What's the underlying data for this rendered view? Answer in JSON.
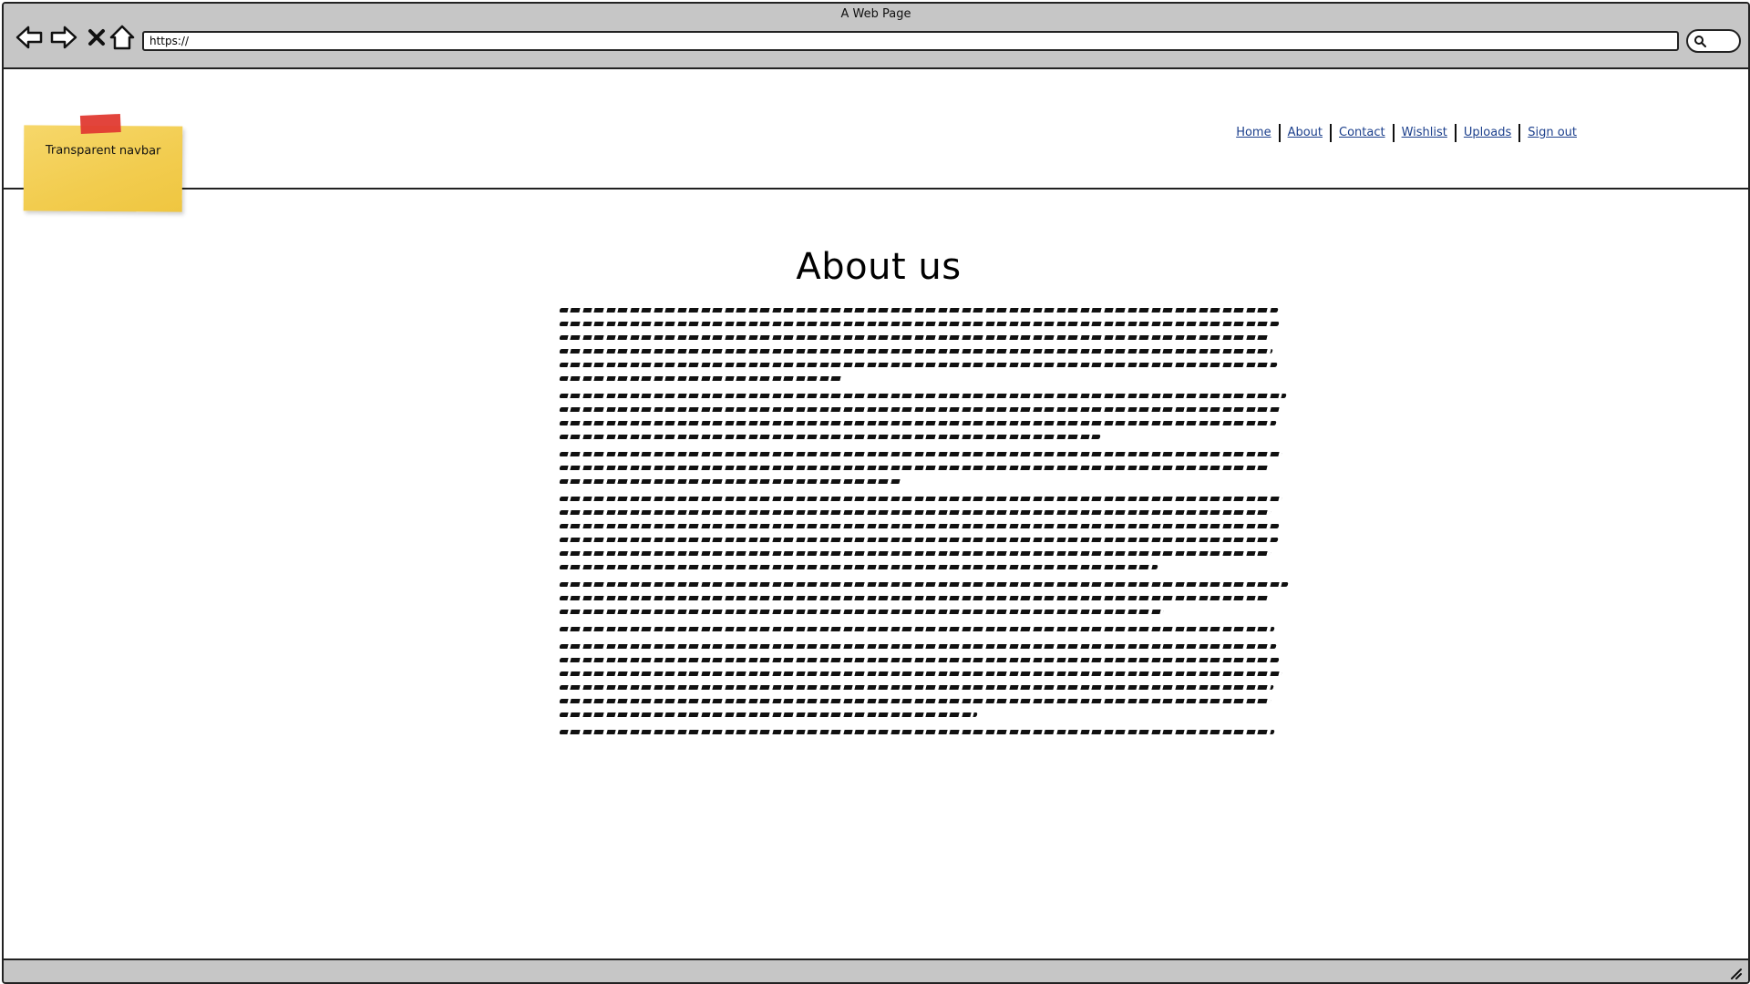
{
  "browser": {
    "window_title": "A Web Page",
    "address": "https://",
    "toolbar_icons": [
      "back-arrow-icon",
      "forward-arrow-icon",
      "close-x-icon",
      "home-icon",
      "search-icon",
      "resize-grip-icon"
    ]
  },
  "navbar": {
    "sticky_note": "Transparent navbar",
    "links": [
      "Home",
      "About",
      "Contact",
      "Wishlist",
      "Uploads",
      "Sign out"
    ]
  },
  "main": {
    "heading": "About us",
    "paragraphs_line_counts": [
      6,
      4,
      3,
      6,
      3,
      1,
      6,
      1
    ]
  },
  "colors": {
    "chrome": "#c6c6c6",
    "link": "#1b3f8c",
    "sticky_note": "#f2cc4e",
    "tape": "#e03a32"
  }
}
